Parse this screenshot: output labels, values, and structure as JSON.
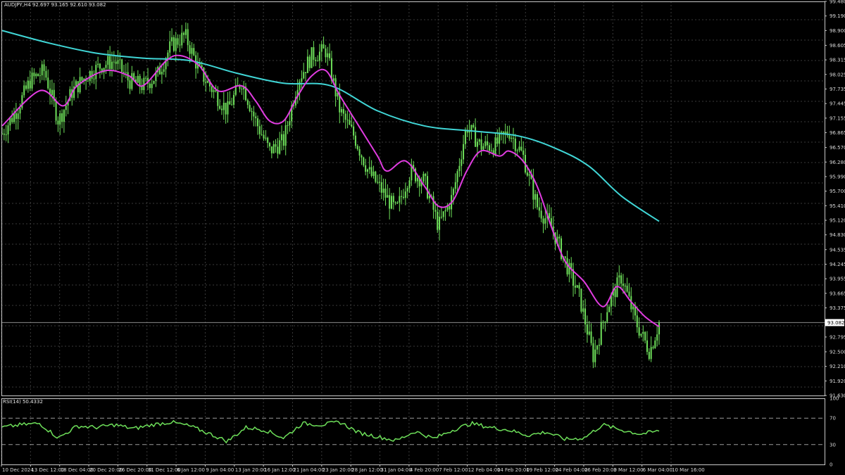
{
  "header": {
    "symbol_info": "AUDJPY,H4  92.697 93.165 92.610 93.082",
    "rsi_label": "RSI(14) 50.4332"
  },
  "colors": {
    "background": "#000000",
    "grid": "#3a3a3a",
    "frame": "#c8c8c8",
    "candles": "#6ee05a",
    "ma_fast": "#e13ce1",
    "ma_slow": "#40d6d6",
    "rsi_line": "#6ee05a",
    "price_tag_bg": "#ffffff",
    "price_tag_text": "#000000"
  },
  "chart_data": [
    {
      "type": "candlestick",
      "title": "AUDJPY,H4",
      "current_price": "93.082",
      "ylim": [
        91.63,
        99.48
      ],
      "price_ticks": [
        "99.480",
        "99.190",
        "98.900",
        "98.605",
        "98.315",
        "98.025",
        "97.735",
        "97.445",
        "97.155",
        "96.865",
        "96.570",
        "96.280",
        "95.990",
        "95.700",
        "95.410",
        "95.120",
        "94.830",
        "94.535",
        "94.245",
        "93.955",
        "93.665",
        "93.375",
        "93.082",
        "92.795",
        "92.500",
        "92.210",
        "91.920",
        "91.630"
      ],
      "time_ticks": [
        "10 Dec 2024",
        "13 Dec 12:00",
        "18 Dec 04:00",
        "20 Dec 20:00",
        "26 Dec 20:00",
        "31 Dec 12:00",
        "6 Jan 12:00",
        "9 Jan 04:00",
        "13 Jan 20:00",
        "16 Jan 12:00",
        "21 Jan 04:00",
        "23 Jan 20:00",
        "28 Jan 12:00",
        "31 Jan 04:00",
        "4 Feb 20:00",
        "7 Feb 12:00",
        "12 Feb 04:00",
        "14 Feb 20:00",
        "19 Feb 12:00",
        "24 Feb 04:00",
        "26 Feb 20:00",
        "3 Mar 12:00",
        "6 Mar 04:00",
        "10 Mar 16:00"
      ],
      "close_path": [
        [
          0,
          96.85
        ],
        [
          3,
          97.3
        ],
        [
          6,
          97.9
        ],
        [
          9,
          98.1
        ],
        [
          12,
          97.1
        ],
        [
          15,
          97.7
        ],
        [
          18,
          98.0
        ],
        [
          21,
          98.2
        ],
        [
          24,
          98.3
        ],
        [
          27,
          97.9
        ],
        [
          30,
          97.8
        ],
        [
          33,
          98.0
        ],
        [
          36,
          98.6
        ],
        [
          39,
          98.8
        ],
        [
          42,
          98.1
        ],
        [
          45,
          97.7
        ],
        [
          48,
          97.3
        ],
        [
          51,
          97.9
        ],
        [
          54,
          97.1
        ],
        [
          57,
          96.5
        ],
        [
          60,
          96.7
        ],
        [
          63,
          97.9
        ],
        [
          66,
          98.4
        ],
        [
          69,
          98.5
        ],
        [
          72,
          97.3
        ],
        [
          75,
          96.8
        ],
        [
          78,
          96.1
        ],
        [
          81,
          95.7
        ],
        [
          84,
          95.3
        ],
        [
          87,
          96.1
        ],
        [
          90,
          95.9
        ],
        [
          93,
          95.0
        ],
        [
          96,
          95.6
        ],
        [
          99,
          97.0
        ],
        [
          102,
          96.6
        ],
        [
          105,
          96.6
        ],
        [
          108,
          96.9
        ],
        [
          111,
          96.4
        ],
        [
          114,
          95.4
        ],
        [
          117,
          95.0
        ],
        [
          120,
          94.3
        ],
        [
          123,
          93.6
        ],
        [
          126,
          92.4
        ],
        [
          129,
          93.4
        ],
        [
          132,
          94.0
        ],
        [
          135,
          93.1
        ],
        [
          138,
          92.5
        ],
        [
          140,
          93.08
        ]
      ],
      "ma_fast": [
        [
          0,
          97.0
        ],
        [
          8,
          97.7
        ],
        [
          13,
          97.4
        ],
        [
          16,
          97.8
        ],
        [
          22,
          98.1
        ],
        [
          27,
          98.0
        ],
        [
          30,
          97.8
        ],
        [
          35,
          98.3
        ],
        [
          38,
          98.4
        ],
        [
          42,
          98.2
        ],
        [
          46,
          97.7
        ],
        [
          51,
          97.8
        ],
        [
          54,
          97.5
        ],
        [
          57,
          97.1
        ],
        [
          60,
          97.1
        ],
        [
          63,
          97.6
        ],
        [
          66,
          98.0
        ],
        [
          69,
          98.1
        ],
        [
          72,
          97.6
        ],
        [
          76,
          97.0
        ],
        [
          80,
          96.4
        ],
        [
          82,
          96.1
        ],
        [
          86,
          96.3
        ],
        [
          90,
          95.8
        ],
        [
          93,
          95.4
        ],
        [
          96,
          95.5
        ],
        [
          99,
          96.1
        ],
        [
          102,
          96.5
        ],
        [
          106,
          96.4
        ],
        [
          108,
          96.5
        ],
        [
          111,
          96.3
        ],
        [
          114,
          95.8
        ],
        [
          117,
          95.0
        ],
        [
          120,
          94.3
        ],
        [
          124,
          93.9
        ],
        [
          128,
          93.4
        ],
        [
          131,
          93.8
        ],
        [
          134,
          93.5
        ],
        [
          137,
          93.2
        ],
        [
          140,
          93.0
        ]
      ],
      "ma_slow": [
        [
          0,
          98.9
        ],
        [
          10,
          98.65
        ],
        [
          20,
          98.45
        ],
        [
          30,
          98.35
        ],
        [
          40,
          98.3
        ],
        [
          50,
          98.05
        ],
        [
          60,
          97.85
        ],
        [
          70,
          97.8
        ],
        [
          80,
          97.3
        ],
        [
          90,
          97.0
        ],
        [
          100,
          96.9
        ],
        [
          110,
          96.8
        ],
        [
          118,
          96.55
        ],
        [
          125,
          96.2
        ],
        [
          132,
          95.6
        ],
        [
          140,
          95.1
        ]
      ]
    },
    {
      "type": "line",
      "title": "RSI(14) 50.4332",
      "ylim": [
        0,
        100
      ],
      "ticks": [
        "100",
        "70",
        "30",
        "0"
      ],
      "levels": [
        70,
        30
      ],
      "x": [
        0,
        4,
        8,
        12,
        16,
        20,
        24,
        28,
        32,
        36,
        40,
        44,
        48,
        52,
        56,
        60,
        64,
        68,
        72,
        76,
        80,
        84,
        88,
        92,
        96,
        100,
        104,
        108,
        112,
        116,
        120,
        124,
        128,
        132,
        136,
        140
      ],
      "values": [
        56,
        60,
        62,
        40,
        58,
        56,
        60,
        54,
        60,
        64,
        58,
        47,
        35,
        56,
        52,
        40,
        62,
        60,
        64,
        48,
        42,
        36,
        50,
        39,
        52,
        62,
        56,
        52,
        44,
        49,
        38,
        40,
        60,
        52,
        46,
        50.4
      ]
    }
  ]
}
